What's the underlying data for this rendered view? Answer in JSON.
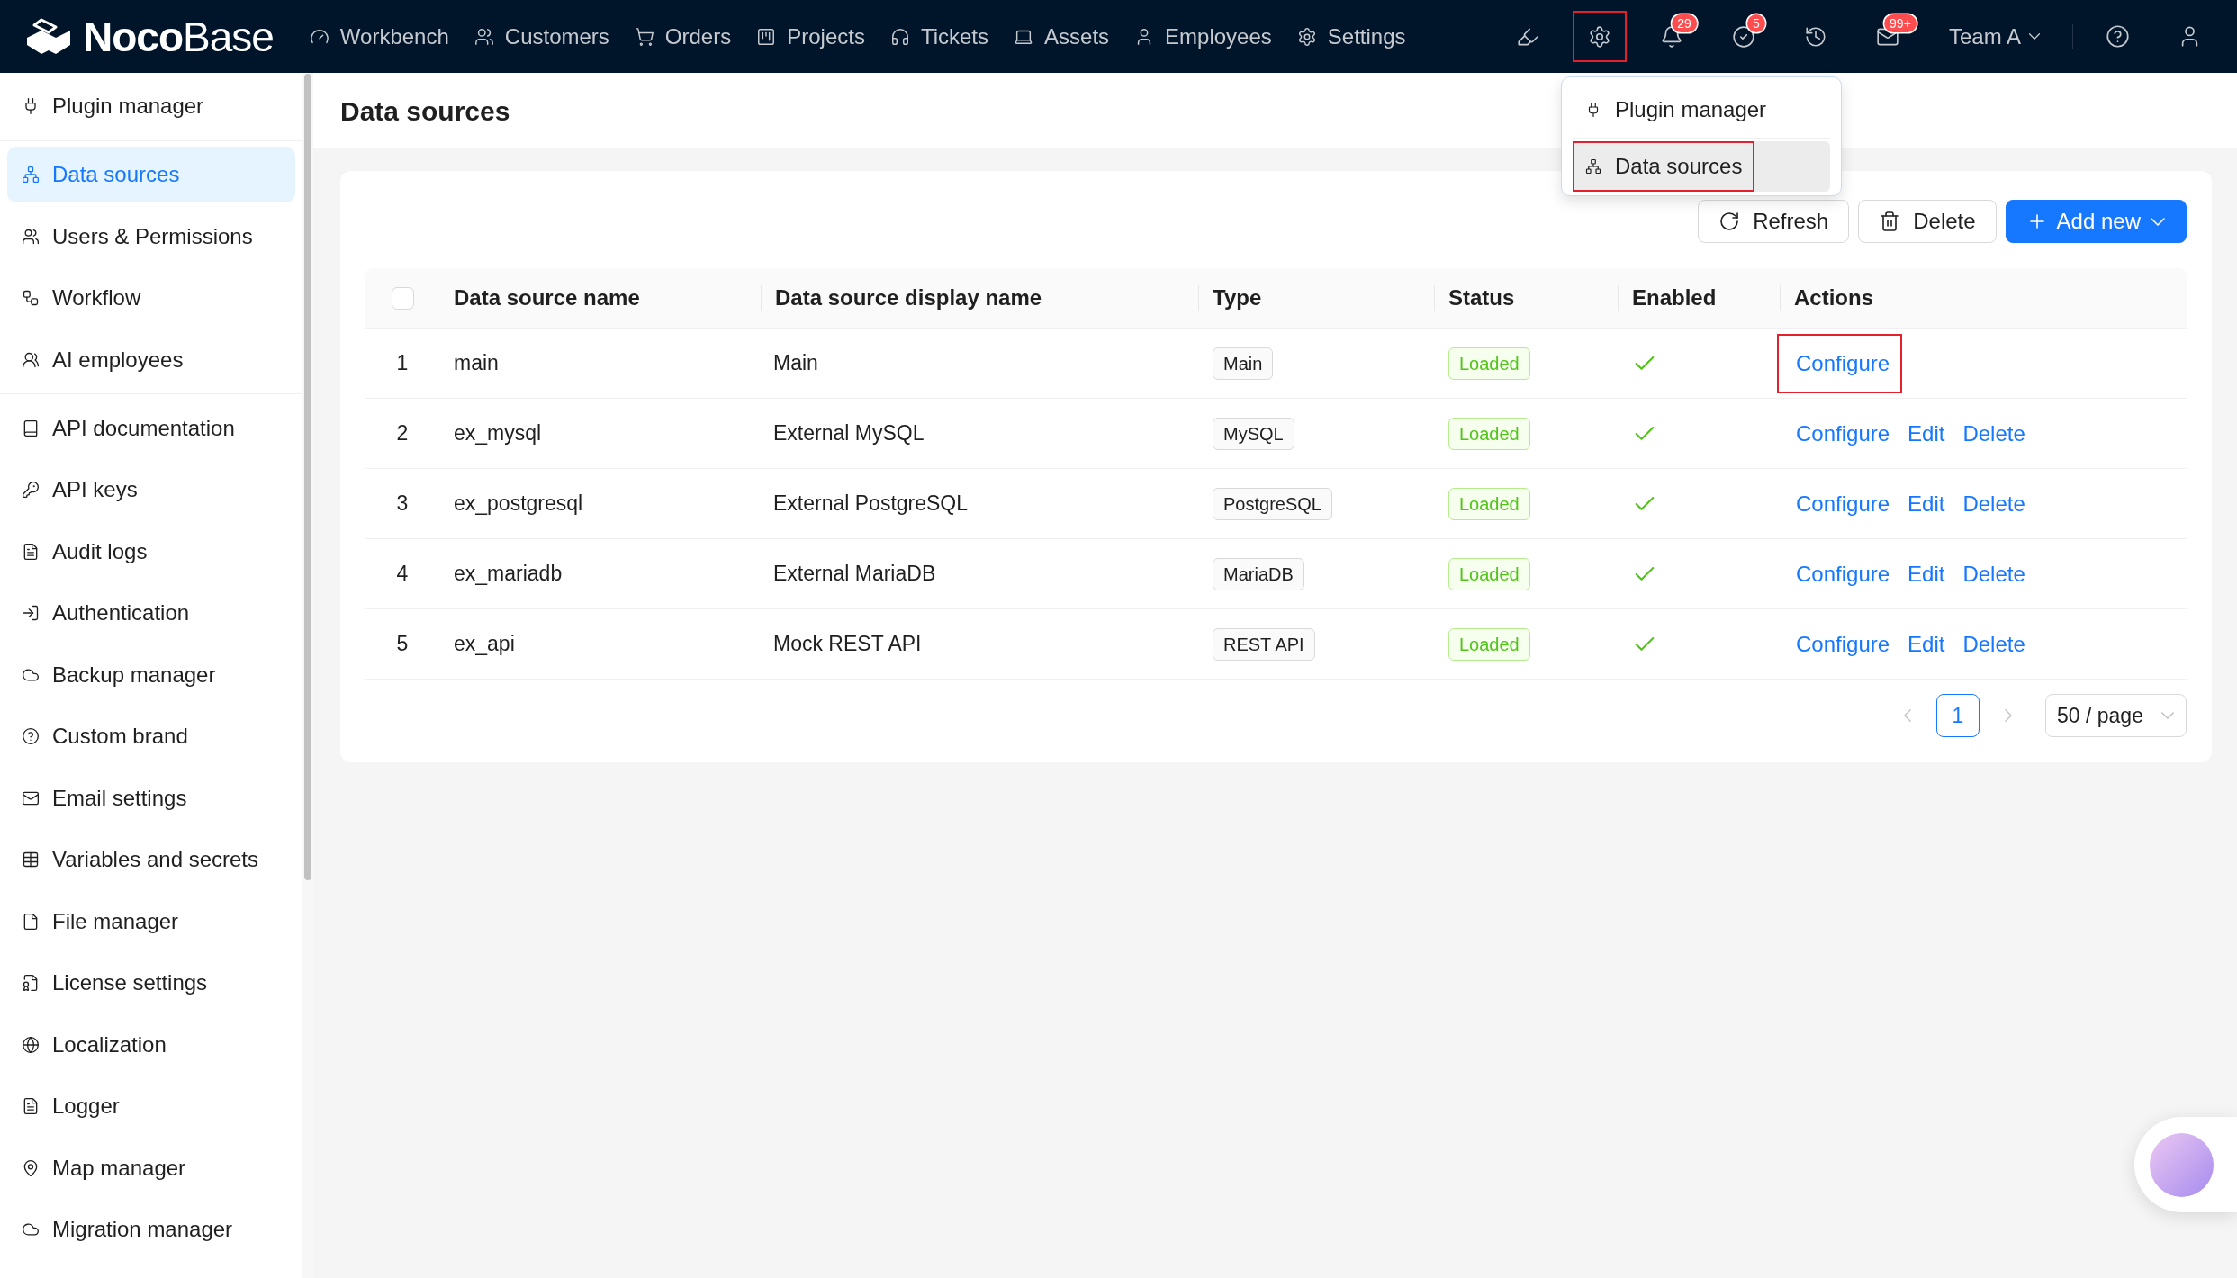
{
  "topbar": {
    "logo": "**Noco**Base",
    "nav": [
      "Workbench",
      "Customers",
      "Orders",
      "Projects",
      "Tickets",
      "Assets",
      "Employees",
      "Settings"
    ],
    "tools": [
      {
        "highlighted": false
      },
      {
        "highlighted": true
      },
      {
        "highlighted": false,
        "badge": "29"
      },
      {
        "highlighted": false,
        "badge": "5"
      },
      {
        "highlighted": false
      },
      {
        "highlighted": false,
        "badge": "99+"
      }
    ],
    "team": "Team A"
  },
  "settings_menu": {
    "items": [
      {
        "label": "Plugin manager",
        "selected": false,
        "highlighted": false
      },
      {
        "label": "Data sources",
        "selected": true,
        "highlighted": true
      }
    ]
  },
  "sidebar": {
    "groups": [
      {
        "items": [
          {
            "label": "Plugin manager",
            "selected": false
          }
        ]
      },
      {
        "items": [
          {
            "label": "Data sources",
            "selected": true
          },
          {
            "label": "Users & Permissions",
            "selected": false
          },
          {
            "label": "Workflow",
            "selected": false
          },
          {
            "label": "AI employees",
            "selected": false
          }
        ]
      },
      {
        "items": [
          {
            "label": "API documentation",
            "selected": false
          },
          {
            "label": "API keys",
            "selected": false
          },
          {
            "label": "Audit logs",
            "selected": false
          },
          {
            "label": "Authentication",
            "selected": false
          },
          {
            "label": "Backup manager",
            "selected": false
          },
          {
            "label": "Custom brand",
            "selected": false
          },
          {
            "label": "Email settings",
            "selected": false
          },
          {
            "label": "Variables and secrets",
            "selected": false
          },
          {
            "label": "File manager",
            "selected": false
          },
          {
            "label": "License settings",
            "selected": false
          },
          {
            "label": "Localization",
            "selected": false
          },
          {
            "label": "Logger",
            "selected": false
          },
          {
            "label": "Map manager",
            "selected": false
          },
          {
            "label": "Migration manager",
            "selected": false
          }
        ]
      }
    ]
  },
  "page": {
    "title": "Data sources"
  },
  "toolbar": {
    "buttons": [
      {
        "kind": "default",
        "label": "Refresh",
        "dropdown": false
      },
      {
        "kind": "default",
        "label": "Delete",
        "dropdown": false
      },
      {
        "kind": "primary",
        "label": "Add new",
        "dropdown": true
      }
    ]
  },
  "table": {
    "select_all_checked": false,
    "columns": [
      "Data source name",
      "Data source display name",
      "Type",
      "Status",
      "Enabled",
      "Actions"
    ],
    "rows": [
      {
        "index": "1",
        "name": "main",
        "display_name": "Main",
        "type": "Main",
        "status": "Loaded",
        "enabled": true,
        "actions": [
          {
            "label": "Configure",
            "highlighted": true
          }
        ]
      },
      {
        "index": "2",
        "name": "ex_mysql",
        "display_name": "External MySQL",
        "type": "MySQL",
        "status": "Loaded",
        "enabled": true,
        "actions": [
          {
            "label": "Configure",
            "highlighted": false
          },
          {
            "label": "Edit",
            "highlighted": false
          },
          {
            "label": "Delete",
            "highlighted": false
          }
        ]
      },
      {
        "index": "3",
        "name": "ex_postgresql",
        "display_name": "External PostgreSQL",
        "type": "PostgreSQL",
        "status": "Loaded",
        "enabled": true,
        "actions": [
          {
            "label": "Configure",
            "highlighted": false
          },
          {
            "label": "Edit",
            "highlighted": false
          },
          {
            "label": "Delete",
            "highlighted": false
          }
        ]
      },
      {
        "index": "4",
        "name": "ex_mariadb",
        "display_name": "External MariaDB",
        "type": "MariaDB",
        "status": "Loaded",
        "enabled": true,
        "actions": [
          {
            "label": "Configure",
            "highlighted": false
          },
          {
            "label": "Edit",
            "highlighted": false
          },
          {
            "label": "Delete",
            "highlighted": false
          }
        ]
      },
      {
        "index": "5",
        "name": "ex_api",
        "display_name": "Mock REST API",
        "type": "REST API",
        "status": "Loaded",
        "enabled": true,
        "actions": [
          {
            "label": "Configure",
            "highlighted": false
          },
          {
            "label": "Edit",
            "highlighted": false
          },
          {
            "label": "Delete",
            "highlighted": false
          }
        ]
      }
    ]
  },
  "pagination": {
    "prev_disabled": true,
    "pages": [
      {
        "label": "1",
        "selected": true
      }
    ],
    "next_disabled": true,
    "page_size": "50 / page"
  }
}
